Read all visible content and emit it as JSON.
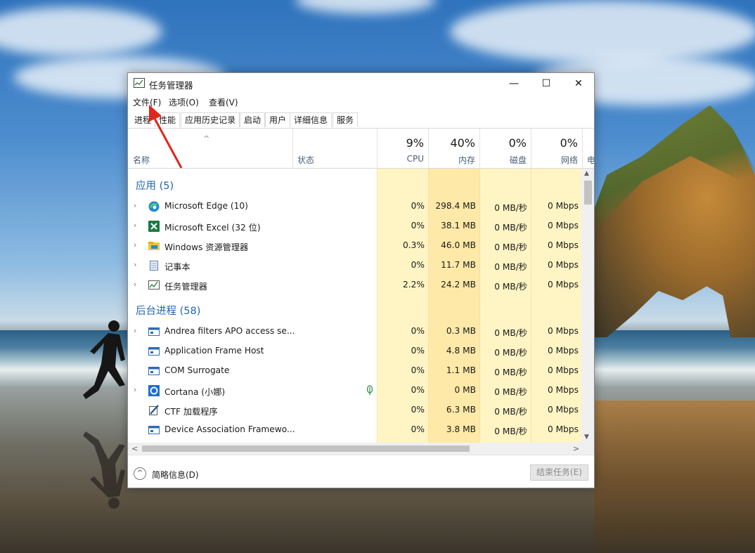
{
  "window": {
    "title": "任务管理器",
    "controls": {
      "minimize": "—",
      "maximize": "☐",
      "close": "✕"
    }
  },
  "menu": [
    "文件(F)",
    "选项(O)",
    "查看(V)"
  ],
  "tabs": [
    "进程",
    "性能",
    "应用历史记录",
    "启动",
    "用户",
    "详细信息",
    "服务"
  ],
  "header": {
    "sort_caret": "^",
    "name": "名称",
    "status": "状态",
    "cpu": {
      "pct": "9%",
      "label": "CPU"
    },
    "memory": {
      "pct": "40%",
      "label": "内存"
    },
    "disk": {
      "pct": "0%",
      "label": "磁盘"
    },
    "network": {
      "pct": "0%",
      "label": "网络"
    },
    "cut_label": "电"
  },
  "groups": {
    "apps": "应用 (5)",
    "background": "后台进程 (58)"
  },
  "apps": [
    {
      "name": "Microsoft Edge (10)",
      "cpu": "0%",
      "mem": "298.4 MB",
      "disk": "0 MB/秒",
      "net": "0 Mbps",
      "icon": "edge-icon",
      "expand": "›"
    },
    {
      "name": "Microsoft Excel (32 位)",
      "cpu": "0%",
      "mem": "38.1 MB",
      "disk": "0 MB/秒",
      "net": "0 Mbps",
      "icon": "excel-icon",
      "expand": "›"
    },
    {
      "name": "Windows 资源管理器",
      "cpu": "0.3%",
      "mem": "46.0 MB",
      "disk": "0 MB/秒",
      "net": "0 Mbps",
      "icon": "explorer-icon",
      "expand": "›"
    },
    {
      "name": "记事本",
      "cpu": "0%",
      "mem": "11.7 MB",
      "disk": "0 MB/秒",
      "net": "0 Mbps",
      "icon": "notepad-icon",
      "expand": "›"
    },
    {
      "name": "任务管理器",
      "cpu": "2.2%",
      "mem": "24.2 MB",
      "disk": "0 MB/秒",
      "net": "0 Mbps",
      "icon": "taskmgr-icon",
      "expand": "›"
    }
  ],
  "background": [
    {
      "name": "Andrea filters APO access se...",
      "cpu": "0%",
      "mem": "0.3 MB",
      "disk": "0 MB/秒",
      "net": "0 Mbps",
      "icon": "service-icon",
      "expand": "›"
    },
    {
      "name": "Application Frame Host",
      "cpu": "0%",
      "mem": "4.8 MB",
      "disk": "0 MB/秒",
      "net": "0 Mbps",
      "icon": "service-icon",
      "expand": ""
    },
    {
      "name": "COM Surrogate",
      "cpu": "0%",
      "mem": "1.1 MB",
      "disk": "0 MB/秒",
      "net": "0 Mbps",
      "icon": "service-icon",
      "expand": ""
    },
    {
      "name": "Cortana (小娜)",
      "cpu": "0%",
      "mem": "0 MB",
      "disk": "0 MB/秒",
      "net": "0 Mbps",
      "icon": "cortana-icon",
      "expand": "›"
    },
    {
      "name": "CTF 加载程序",
      "cpu": "0%",
      "mem": "6.3 MB",
      "disk": "0 MB/秒",
      "net": "0 Mbps",
      "icon": "ctf-icon",
      "expand": ""
    },
    {
      "name": "Device Association Framewo...",
      "cpu": "0%",
      "mem": "3.8 MB",
      "disk": "0 MB/秒",
      "net": "0 Mbps",
      "icon": "service-icon",
      "expand": ""
    }
  ],
  "scroll": {
    "up": "▲",
    "down": "▼",
    "left": "<",
    "right": ">"
  },
  "footer": {
    "fewer_details_icon": "^",
    "fewer_details": "简略信息(D)",
    "end_task": "结束任务(E)"
  },
  "colors": {
    "cpu_bg": "#fff4c4",
    "mem_bg": "#ffe9a8",
    "group_blue": "#1e64b4",
    "arrow_red": "#e0261c"
  }
}
